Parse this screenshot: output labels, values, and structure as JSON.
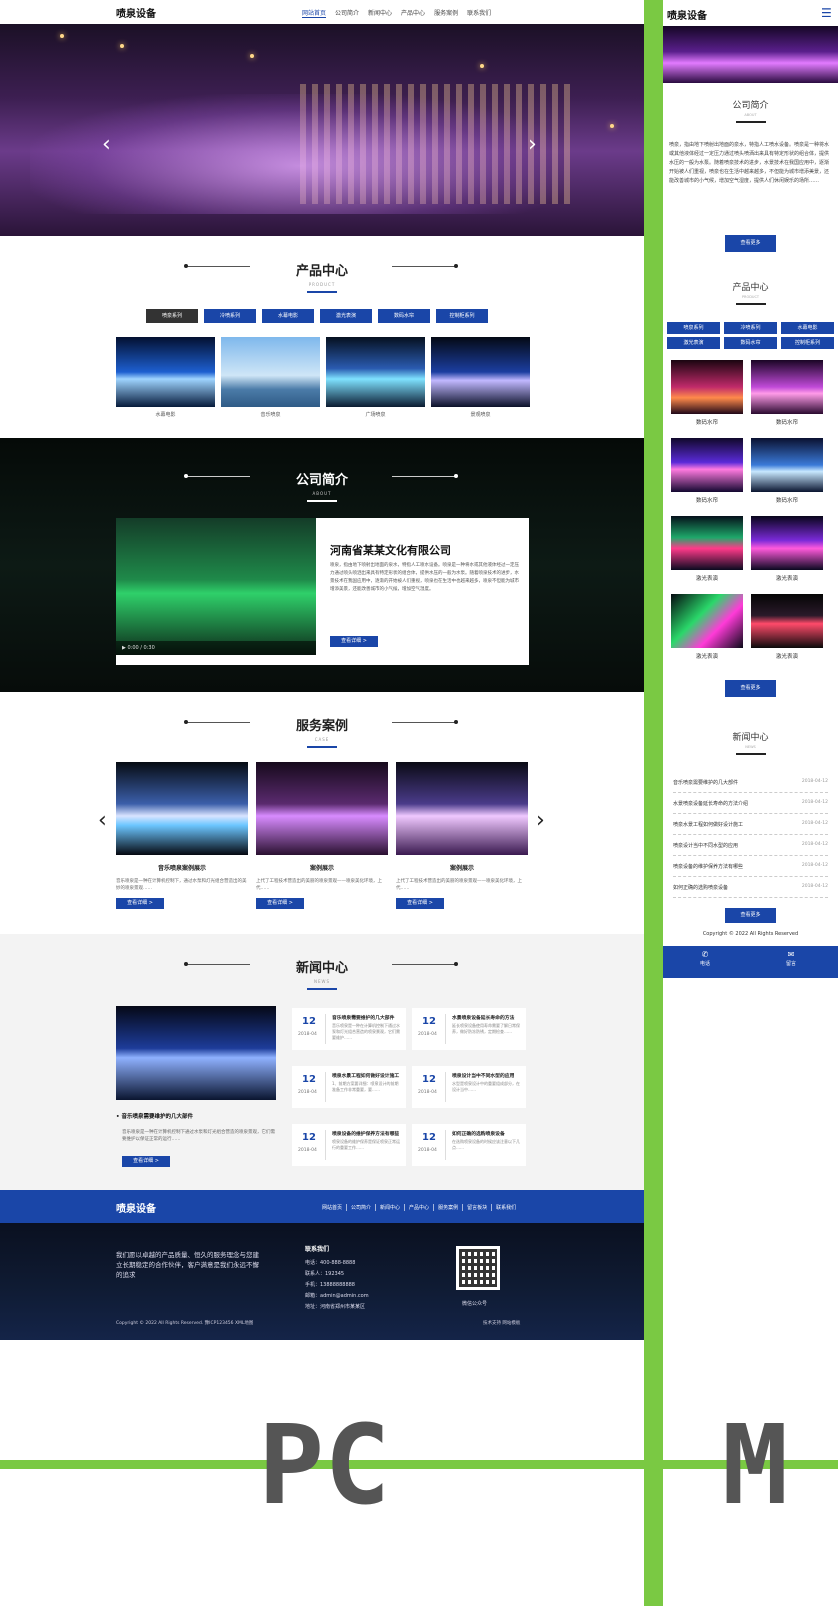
{
  "pc": {
    "logo": "喷泉设备",
    "nav": [
      "网站首页",
      "公司简介",
      "新闻中心",
      "产品中心",
      "服务案例",
      "联系我们"
    ],
    "products": {
      "title": "产品中心",
      "subtitle": "PRODUCT",
      "tabs": [
        "喷泉系列",
        "冷喷系列",
        "水幕电影",
        "激光表演",
        "数码水帘",
        "控制柜系列"
      ],
      "items": [
        "水幕电影",
        "音乐喷泉",
        "广场喷泉",
        "景观喷泉"
      ]
    },
    "about": {
      "title": "公司简介",
      "subtitle": "ABOUT",
      "company": "河南省某某文化有限公司",
      "video_time": "0:00 / 0:30",
      "text": "喷泉，指由地下喷射出地面的泉水，特指人工喷水设备。喷泉是一种将水或其他液体经过一定压力通过喷头喷洒出来具有特定形状的组合体，提供水压的一般为水泵。随着喷泉技术的进步，水景技术在我国应用中，逐渐的开始被人们重视，喷泉也在生活中也越来越多，喷泉不但能为城市增添美景，还能改善城市的小气候，增加空气湿度。",
      "more": "查看详细 >"
    },
    "cases": {
      "title": "服务案例",
      "subtitle": "CASE",
      "items": [
        {
          "title": "音乐喷泉案例展示",
          "desc": "音乐喷泉是一种在计算机控制下，通过水泵和灯光组合营造出的美妙的喷泉景观……",
          "more": "查看详细 >"
        },
        {
          "title": "案例展示",
          "desc": "上代了工程技术营造出的美丽的喷泉景观——喷泉美化环境，上代……",
          "more": "查看详细 >"
        },
        {
          "title": "案例展示",
          "desc": "上代了工程技术营造出的美丽的喷泉景观——喷泉美化环境，上代……",
          "more": "查看详细 >"
        }
      ]
    },
    "news": {
      "title": "新闻中心",
      "subtitle": "NEWS",
      "main_title": "音乐喷泉需要维护的几大部件",
      "main_desc": "音乐喷泉是一种在计算机控制下通过水泵和灯光组合营造的喷泉景观，它们需要维护以保证正常的运行……",
      "more": "查看详细 >",
      "cards": [
        {
          "day": "12",
          "ym": "2018-04",
          "title": "音乐喷泉需要维护的几大部件",
          "desc": "音乐喷泉是一种在计算机控制下通过水泵和灯光组合营造的喷泉景观，它们需要维护……"
        },
        {
          "day": "12",
          "ym": "2018-04",
          "title": "水景喷泉设备延长寿命的方法",
          "desc": "延长喷泉设备使用寿命需要了解日常保养，做好防冻防锈，定期检查……"
        },
        {
          "day": "12",
          "ym": "2018-04",
          "title": "喷泉水景工程如何做好设计施工",
          "desc": "1、前期方案要详细：喷泉设计的前期准备工作非常重要，要……"
        },
        {
          "day": "12",
          "ym": "2018-04",
          "title": "喷泉设计当中不同水型的应用",
          "desc": "水型是喷泉设计中的重要组成部分，在设计当中……"
        },
        {
          "day": "12",
          "ym": "2018-04",
          "title": "喷泉设备的维护保养方法有哪些",
          "desc": "喷泉设备的维护保养是保证喷泉正常运行的重要工作……"
        },
        {
          "day": "12",
          "ym": "2018-04",
          "title": "如何正确的选购喷泉设备",
          "desc": "在选购喷泉设备的时候应该注意以下几点……"
        }
      ]
    },
    "footer": {
      "logo": "喷泉设备",
      "menu": [
        "网站首页",
        "公司简介",
        "新闻中心",
        "产品中心",
        "服务案例",
        "留言板块",
        "联系我们"
      ],
      "slogan": "我们愿以卓越的产品质量、恒久的服务理念与您建立长期稳定的合作伙伴，客户满意是我们永远不懈的追求",
      "contact_title": "联系我们",
      "contact": [
        "电话：400-888-8888",
        "联系人：192345",
        "手机：13888888888",
        "邮箱：admin@admin.com",
        "地址：河南省郑州市某某区"
      ],
      "qr_caption": "微信公众号",
      "copyright": "Copyright © 2022 All Rights Reserved. 豫ICP123456 XML地图",
      "links": "技术支持   网站模板"
    }
  },
  "mobile": {
    "logo": "喷泉设备",
    "about_title": "公司简介",
    "about_sub": "ABOUT",
    "about_text": "喷泉，指由地下喷射出地面的泉水，特指人工喷水设备。喷泉是一种将水或其他液体经过一定压力通过喷头喷洒出来具有特定形状的组合体，提供水压的一般为水泵。随着喷泉技术的进步，水景技术在我国应用中，逐渐开始被人们重视，喷泉也在生活中越来越多，不但能为城市增添美景，还能改善城市的小气候，增加空气湿度，提供人们休闲娱乐的场所……",
    "more": "查看更多",
    "product_title": "产品中心",
    "product_sub": "PRODUCT",
    "tabs": [
      "喷泉系列",
      "冷喷系列",
      "水幕电影",
      "激光表演",
      "数码水帘",
      "控制柜系列"
    ],
    "products": [
      "数码水帘",
      "数码水帘",
      "数码水帘",
      "数码水帘",
      "激光表演",
      "激光表演",
      "激光表演",
      "激光表演"
    ],
    "news_title": "新闻中心",
    "news_sub": "NEWS",
    "news": [
      {
        "title": "音乐喷泉需要维护的几大部件",
        "date": "2018-04-12"
      },
      {
        "title": "水景喷泉设备延长寿命的方法介绍",
        "date": "2018-04-12"
      },
      {
        "title": "喷泉水景工程如何做好设计施工",
        "date": "2018-04-12"
      },
      {
        "title": "喷泉设计当中不同水型的应用",
        "date": "2018-04-12"
      },
      {
        "title": "喷泉设备的维护保养方法有哪些",
        "date": "2018-04-12"
      },
      {
        "title": "如何正确的选购喷泉设备",
        "date": "2018-04-12"
      }
    ],
    "copyright": "Copyright © 2022 All Rights Reserved",
    "bottom": [
      {
        "icon": "phone-icon",
        "label": "电话"
      },
      {
        "icon": "message-icon",
        "label": "留言"
      }
    ]
  },
  "labels": {
    "pc": "PC",
    "mobile": "M"
  },
  "colors": {
    "accent": "#1a46a8",
    "frame": "#7ac943"
  }
}
